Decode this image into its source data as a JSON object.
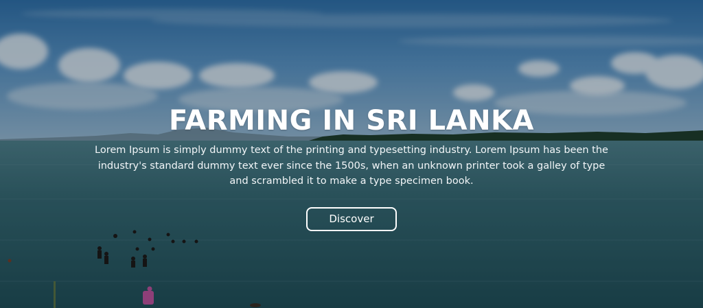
{
  "hero": {
    "title": "FARMING IN SRI LANKA",
    "description": "Lorem Ipsum is simply dummy text of the printing and typesetting industry. Lorem Ipsum has been the industry's standard dummy text ever since the 1500s, when an unknown printer took a galley of type and scrambled it to make a type specimen book.",
    "button_label": "Discover",
    "background_image": "lake-with-people-wading-photo"
  },
  "colors": {
    "text": "#ffffff",
    "sky": "#3f7fb3",
    "water": "#2a5a62"
  }
}
